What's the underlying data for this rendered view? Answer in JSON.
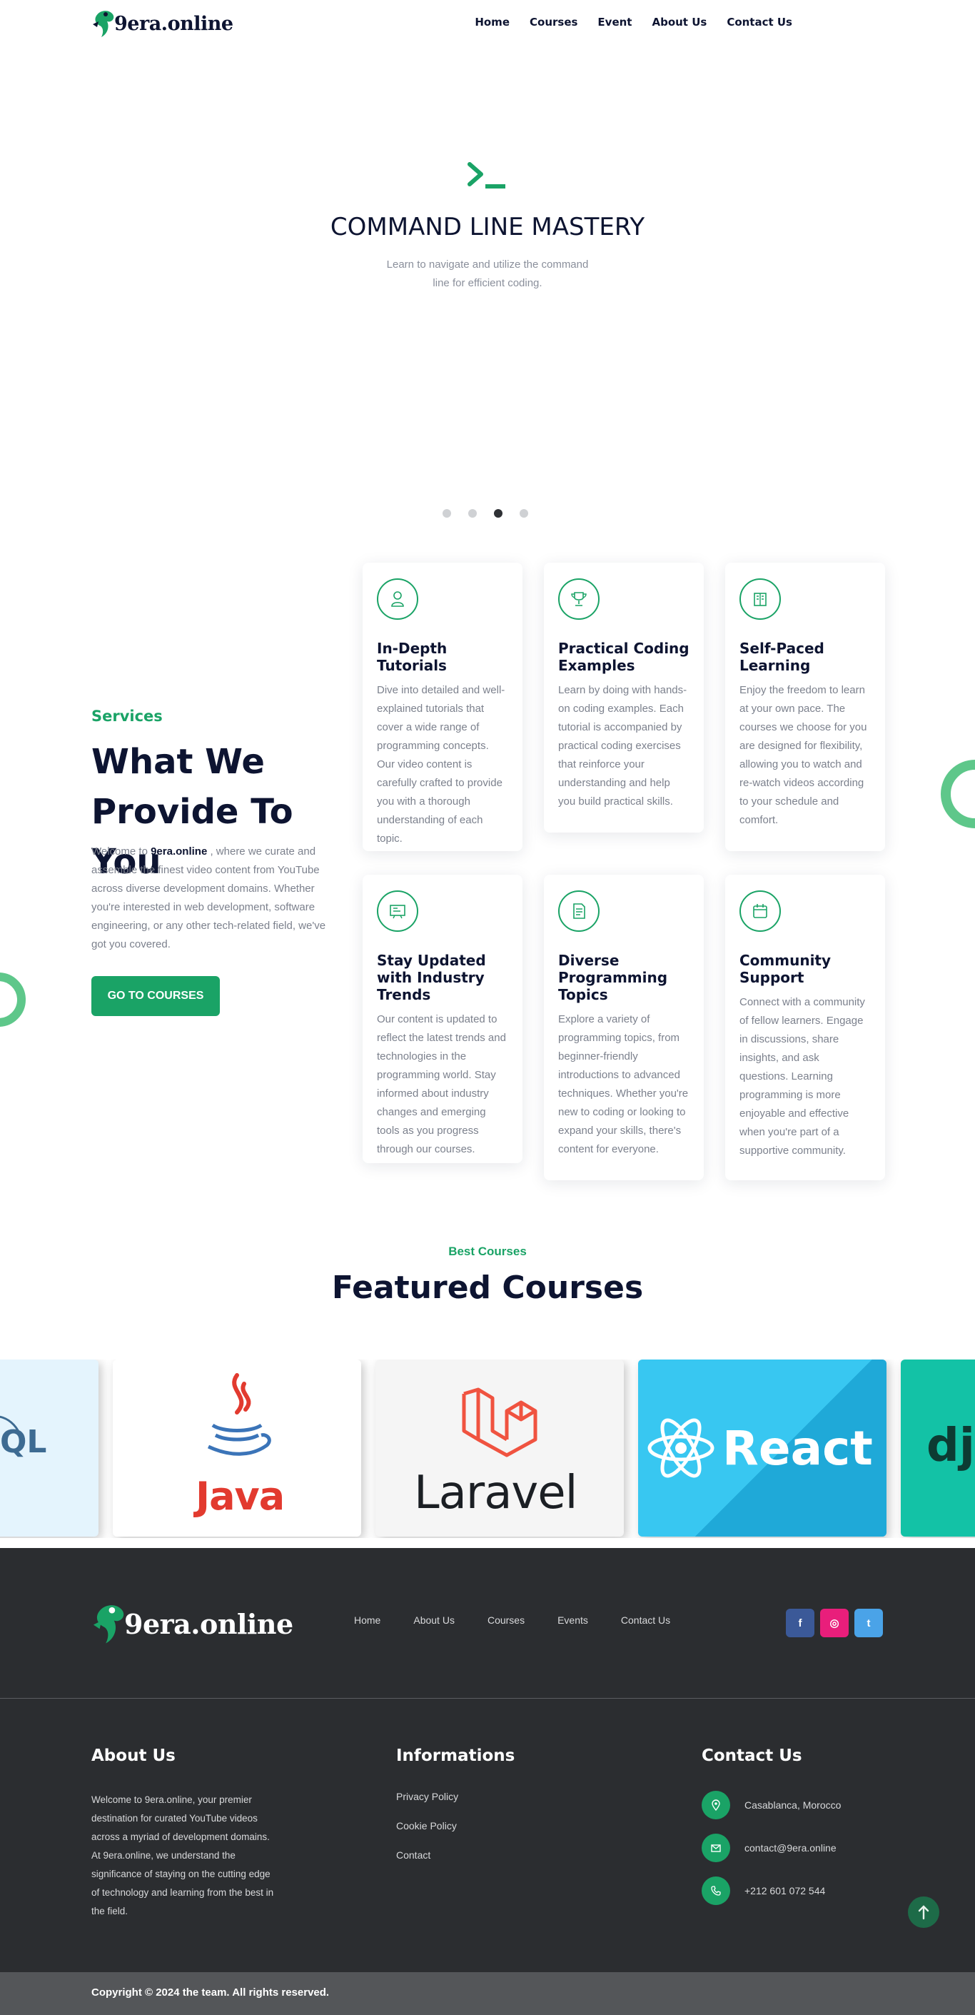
{
  "brand": {
    "name": "9era.online",
    "logo_icon": "green-figure-logo-icon"
  },
  "nav": [
    "Home",
    "Courses",
    "Event",
    "About Us",
    "Contact Us"
  ],
  "hero": {
    "icon": "terminal-prompt-icon",
    "title": "COMMAND LINE MASTERY",
    "subtitle": "Learn to navigate and utilize the command line for efficient coding.",
    "slides": 4,
    "active_slide": 3
  },
  "services": {
    "tag": "Services",
    "title": "What We Provide To You",
    "desc_before": "Welcome to ",
    "desc_brand": "9era.online",
    "desc_after": " , where we curate and assemble the finest video content from YouTube across diverse development domains. Whether you're interested in web development, software engineering, or any other tech-related field, we've got you covered.",
    "button": "GO TO COURSES",
    "cards": [
      {
        "icon": "tutor-icon",
        "title": "In-Depth Tutorials",
        "text": "Dive into detailed and well-explained tutorials that cover a wide range of programming concepts. Our video content is carefully crafted to provide you with a thorough understanding of each topic."
      },
      {
        "icon": "trophy-icon",
        "title": "Practical Coding Examples",
        "text": "Learn by doing with hands-on coding examples. Each tutorial is accompanied by practical coding exercises that reinforce your understanding and help you build practical skills."
      },
      {
        "icon": "book-icon",
        "title": "Self-Paced Learning",
        "text": "Enjoy the freedom to learn at your own pace. The courses we choose for you are designed for flexibility, allowing you to watch and re-watch videos according to your schedule and comfort."
      },
      {
        "icon": "board-icon",
        "title": "Stay Updated with Industry Trends",
        "text": "Our content is updated to reflect the latest trends and technologies in the programming world. Stay informed about industry changes and emerging tools as you progress through our courses."
      },
      {
        "icon": "document-icon",
        "title": "Diverse Programming Topics",
        "text": "Explore a variety of programming topics, from beginner-friendly introductions to advanced techniques. Whether you're new to coding or looking to expand your skills, there's content for everyone."
      },
      {
        "icon": "calendar-icon",
        "title": "Community Support",
        "text": "Connect with a community of fellow learners. Engage in discussions, share insights, and ask questions. Learning programming is more enjoyable and effective when you're part of a supportive community."
      }
    ]
  },
  "featured": {
    "tag": "Best Courses",
    "title": "Featured Courses",
    "courses": [
      {
        "name": "MySQL",
        "label": "QL",
        "bg": "#e4f4fd"
      },
      {
        "name": "Java",
        "label": "Java",
        "bg": "#ffffff"
      },
      {
        "name": "Laravel",
        "label": "Laravel",
        "bg": "#f5f5f5"
      },
      {
        "name": "React",
        "label": "React",
        "bg": "#38c7f1"
      },
      {
        "name": "Django",
        "label": "dja",
        "bg": "#13c2a6"
      }
    ]
  },
  "footer": {
    "nav": [
      "Home",
      "About Us",
      "Courses",
      "Events",
      "Contact Us"
    ],
    "socials": [
      {
        "name": "facebook",
        "glyph": "f",
        "color": "#3b5998"
      },
      {
        "name": "instagram",
        "glyph": "◎",
        "color": "#e91e7b"
      },
      {
        "name": "twitter",
        "glyph": "t",
        "color": "#4aa3e8"
      }
    ],
    "about_title": "About Us",
    "about_text": "Welcome to 9era.online, your premier destination for curated YouTube videos across a myriad of development domains. At 9era.online, we understand the significance of staying on the cutting edge of technology and learning from the best in the field.",
    "info_title": "Informations",
    "info_links": [
      "Privacy Policy",
      "Cookie Policy",
      "Contact"
    ],
    "contact_title": "Contact Us",
    "contacts": [
      {
        "icon": "location-pin-icon",
        "text": "Casablanca, Morocco"
      },
      {
        "icon": "envelope-icon",
        "text": "contact@9era.online"
      },
      {
        "icon": "phone-icon",
        "text": "+212 601 072 544"
      }
    ],
    "copyright": "Copyright © 2024 the team. All rights reserved."
  },
  "colors": {
    "accent": "#1aa366",
    "dark": "#0d1431",
    "footer_bg": "#2b2d30"
  }
}
